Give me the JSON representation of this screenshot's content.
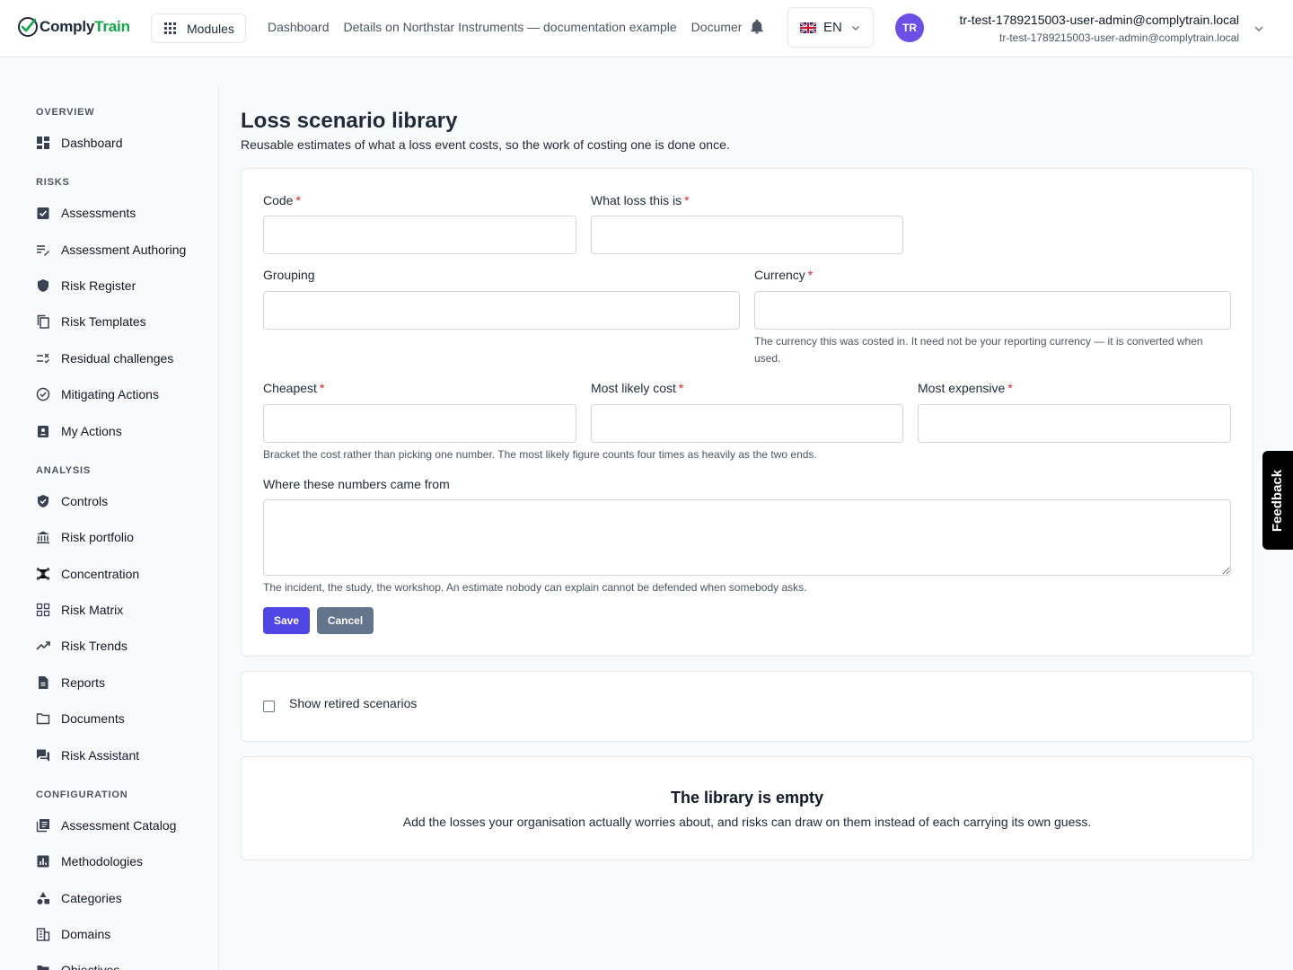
{
  "header": {
    "logo_part1": "Comply",
    "logo_part2": "Train",
    "modules_label": "Modules",
    "breadcrumbs": [
      "Dashboard",
      "Details on Northstar Instruments — documentation example",
      "Documents"
    ],
    "lang_label": "EN",
    "avatar_initials": "TR",
    "user_name": "tr-test-1789215003-user-admin@complytrain.local",
    "user_email": "tr-test-1789215003-user-admin@complytrain.local"
  },
  "sidebar": {
    "sections": [
      {
        "title": "OVERVIEW",
        "items": [
          {
            "label": "Dashboard",
            "icon": "dashboard-icon"
          }
        ]
      },
      {
        "title": "RISKS",
        "items": [
          {
            "label": "Assessments",
            "icon": "assignment-check-icon"
          },
          {
            "label": "Assessment Authoring",
            "icon": "edit-list-icon"
          },
          {
            "label": "Risk Register",
            "icon": "shield-icon"
          },
          {
            "label": "Risk Templates",
            "icon": "copy-icon"
          },
          {
            "label": "Residual challenges",
            "icon": "rule-icon"
          },
          {
            "label": "Mitigating Actions",
            "icon": "check-circle-icon"
          },
          {
            "label": "My Actions",
            "icon": "assignment-ind-icon"
          }
        ]
      },
      {
        "title": "ANALYSIS",
        "items": [
          {
            "label": "Controls",
            "icon": "verified-shield-icon"
          },
          {
            "label": "Risk portfolio",
            "icon": "bank-icon"
          },
          {
            "label": "Concentration",
            "icon": "hub-icon"
          },
          {
            "label": "Risk Matrix",
            "icon": "grid-icon"
          },
          {
            "label": "Risk Trends",
            "icon": "trending-up-icon"
          },
          {
            "label": "Reports",
            "icon": "document-icon"
          },
          {
            "label": "Documents",
            "icon": "folder-icon"
          },
          {
            "label": "Risk Assistant",
            "icon": "chat-icon"
          }
        ]
      },
      {
        "title": "CONFIGURATION",
        "items": [
          {
            "label": "Assessment Catalog",
            "icon": "catalog-icon"
          },
          {
            "label": "Methodologies",
            "icon": "chart-box-icon"
          },
          {
            "label": "Categories",
            "icon": "shapes-icon"
          },
          {
            "label": "Domains",
            "icon": "building-icon"
          },
          {
            "label": "Objectives",
            "icon": "folder-icon"
          }
        ]
      }
    ]
  },
  "page": {
    "title": "Loss scenario library",
    "subtitle": "Reusable estimates of what a loss event costs, so the work of costing one is done once."
  },
  "form": {
    "code_label": "Code",
    "what_label": "What loss this is",
    "grouping_label": "Grouping",
    "currency_label": "Currency",
    "currency_help": "The currency this was costed in. It need not be your reporting currency — it is converted when used.",
    "cheapest_label": "Cheapest",
    "likely_label": "Most likely cost",
    "expensive_label": "Most expensive",
    "bracket_help": "Bracket the cost rather than picking one number. The most likely figure counts four times as heavily as the two ends.",
    "source_label": "Where these numbers came from",
    "source_help": "The incident, the study, the workshop. An estimate nobody can explain cannot be defended when somebody asks.",
    "required_marker": "*",
    "save_label": "Save",
    "cancel_label": "Cancel"
  },
  "retired": {
    "label": "Show retired scenarios",
    "checked": false
  },
  "empty": {
    "title": "The library is empty",
    "text": "Add the losses your organisation actually worries about, and risks can draw on them instead of each carrying its own guess."
  },
  "feedback_label": "Feedback",
  "colors": {
    "primary": "#4f46e5",
    "secondary": "#64748b",
    "brand_green": "#16a34a",
    "required": "#dc2626",
    "avatar": "#6d4fe6"
  }
}
